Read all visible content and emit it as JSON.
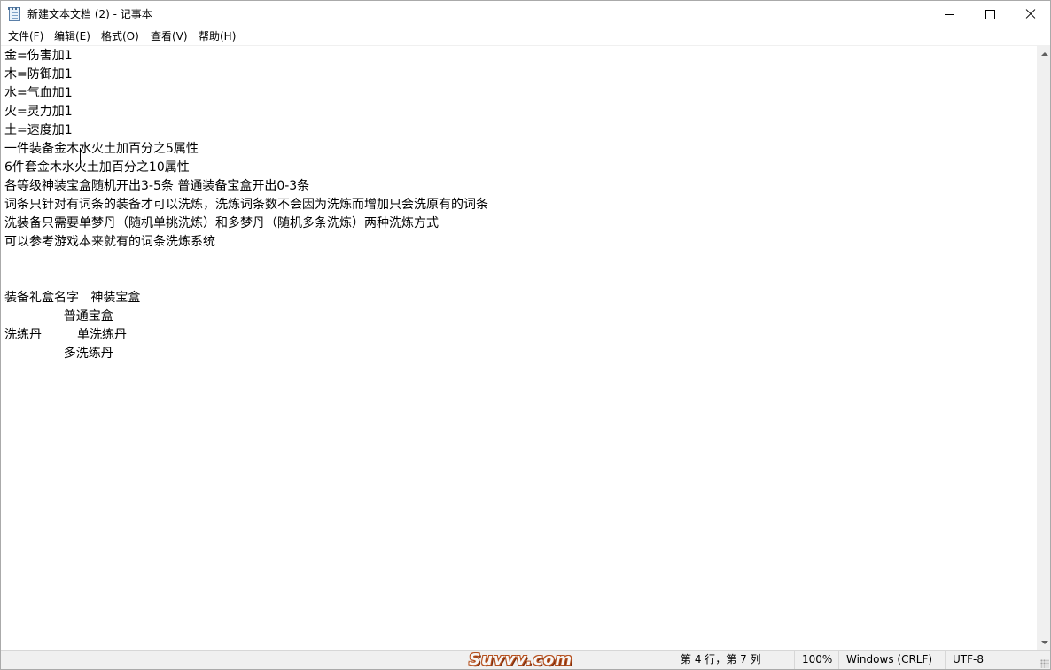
{
  "window": {
    "title": "新建文本文档 (2) - 记事本",
    "icon": "notepad-icon"
  },
  "controls": {
    "minimize_icon": "minimize-icon",
    "maximize_icon": "maximize-icon",
    "close_icon": "close-icon"
  },
  "menu": {
    "items": [
      {
        "label": "文件(F)"
      },
      {
        "label": "编辑(E)"
      },
      {
        "label": "格式(O)"
      },
      {
        "label": "查看(V)"
      },
      {
        "label": "帮助(H)"
      }
    ]
  },
  "editor": {
    "text": "金=伤害加1\n木=防御加1\n水=气血加1\n火=灵力加1\n土=速度加1\n一件装备金木水火土加百分之5属性\n6件套金木水火土加百分之10属性\n各等级神装宝盒随机开出3-5条 普通装备宝盒开出0-3条\n词条只针对有词条的装备才可以洗炼，洗炼词条数不会因为洗炼而增加只会洗原有的词条\n洗装备只需要单梦丹（随机单挑洗炼）和多梦丹（随机多条洗炼）两种洗炼方式\n可以参考游戏本来就有的词条洗炼系统\n\n\n装备礼盒名字   神装宝盒\n               普通宝盒\n洗练丹         单洗练丹\n               多洗练丹"
  },
  "status": {
    "position": "第 4 行，第 7 列",
    "zoom": "100%",
    "line_ending": "Windows (CRLF)",
    "encoding": "UTF-8"
  },
  "watermark": {
    "text": "Suvvv.com"
  }
}
